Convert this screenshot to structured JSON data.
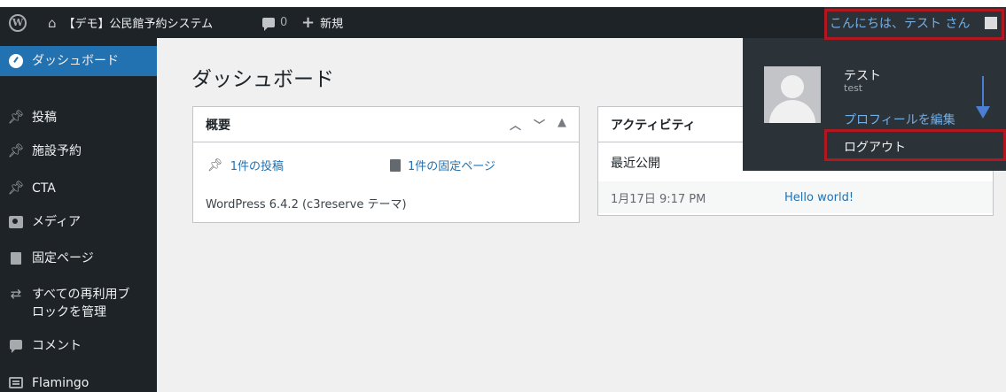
{
  "adminbar": {
    "wp_logo_glyph": "W",
    "site_name": "【デモ】公民館予約システム",
    "comments_count": "0",
    "new_label": "新規",
    "greeting": "こんにちは、テスト さん"
  },
  "sidebar": {
    "items": [
      {
        "label": "ダッシュボード",
        "icon": "dashboard-icon"
      },
      {
        "label": "投稿",
        "icon": "pin-icon"
      },
      {
        "label": "施設予約",
        "icon": "pin-icon"
      },
      {
        "label": "CTA",
        "icon": "pin-icon"
      },
      {
        "label": "メディア",
        "icon": "media-icon"
      },
      {
        "label": "固定ページ",
        "icon": "page-icon"
      },
      {
        "label": "すべての再利用ブロックを管理",
        "line1": "すべての再利用ブ",
        "line2": "ロックを管理",
        "icon": "reusable-block-icon"
      },
      {
        "label": "コメント",
        "icon": "comment-icon"
      },
      {
        "label": "Flamingo",
        "icon": "flamingo-icon"
      }
    ]
  },
  "main": {
    "page_title": "ダッシュボード",
    "at_a_glance": {
      "title": "概要",
      "posts_link": "1件の投稿",
      "pages_link": "1件の固定ページ",
      "version_text": "WordPress 6.4.2 (c3reserve テーマ)"
    },
    "activity": {
      "title": "アクティビティ",
      "subtitle": "最近公開",
      "rows": [
        {
          "date": "1月17日 9:17 PM",
          "title": "Hello world!"
        }
      ]
    }
  },
  "dropdown": {
    "display_name": "テスト",
    "login": "test",
    "edit_profile": "プロフィールを編集",
    "logout": "ログアウト"
  },
  "colors": {
    "adminbar_bg": "#1d2327",
    "accent": "#2271b1",
    "link": "#72aee6",
    "highlight_box": "#b0171e",
    "annotation_arrow": "#4a7fd3"
  }
}
